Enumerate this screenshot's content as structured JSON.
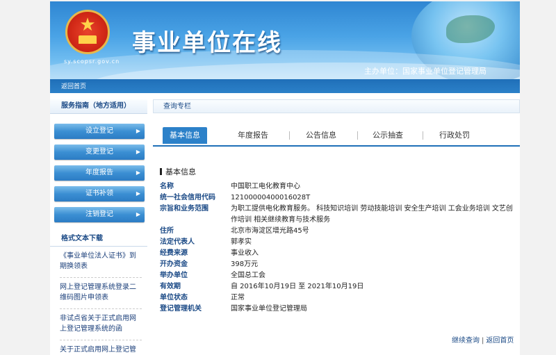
{
  "header": {
    "site_title": "事业单位在线",
    "site_url": "sy.scopsr.gov.cn",
    "sponsor": "主办单位：国家事业单位登记管理局",
    "home_link": "返回首页"
  },
  "sidebar": {
    "service_title": "服务指南（地方适用）",
    "services": [
      {
        "label": "设立登记"
      },
      {
        "label": "变更登记"
      },
      {
        "label": "年度报告"
      },
      {
        "label": "证书补领"
      },
      {
        "label": "注销登记"
      }
    ],
    "format_title": "格式文本下载",
    "documents": [
      {
        "label": "《事业单位法人证书》到期换领表"
      },
      {
        "label": "网上登记管理系统登录二维码图片申领表"
      },
      {
        "label": "非试点省关于正式启用网上登记管理系统的函"
      },
      {
        "label": "关于正式启用网上登记管"
      }
    ]
  },
  "main": {
    "section_head": "查询专栏",
    "tabs": [
      {
        "label": "基本信息",
        "active": true
      },
      {
        "label": "年度报告"
      },
      {
        "label": "公告信息"
      },
      {
        "label": "公示抽查"
      },
      {
        "label": "行政处罚"
      }
    ],
    "info_title": "基本信息",
    "fields": [
      {
        "label": "名称",
        "value": "中国职工电化教育中心"
      },
      {
        "label": "统一社会信用代码",
        "value": "12100000400016028T"
      },
      {
        "label": "宗旨和业务范围",
        "value": "为职工提供电化教育服务。 科技知识培训 劳动技能培训 安全生产培训 工会业务培训 文艺创作培训 相关继续教育与技术服务"
      },
      {
        "label": "住所",
        "value": "北京市海淀区增光路45号"
      },
      {
        "label": "法定代表人",
        "value": "郭孝实"
      },
      {
        "label": "经费来源",
        "value": "事业收入"
      },
      {
        "label": "开办资金",
        "value": "398万元"
      },
      {
        "label": "举办单位",
        "value": "全国总工会"
      },
      {
        "label": "有效期",
        "value": "自 2016年10月19日 至 2021年10月19日"
      },
      {
        "label": "单位状态",
        "value": "正常"
      },
      {
        "label": "登记管理机关",
        "value": "国家事业单位登记管理局"
      }
    ]
  },
  "footer": {
    "continue_query": "继续查询",
    "separator": "|",
    "back_home": "返回首页"
  },
  "colors": {
    "brand_blue": "#1f6fb8",
    "label_blue": "#1b4a86",
    "tab_active": "#2c81c9"
  }
}
